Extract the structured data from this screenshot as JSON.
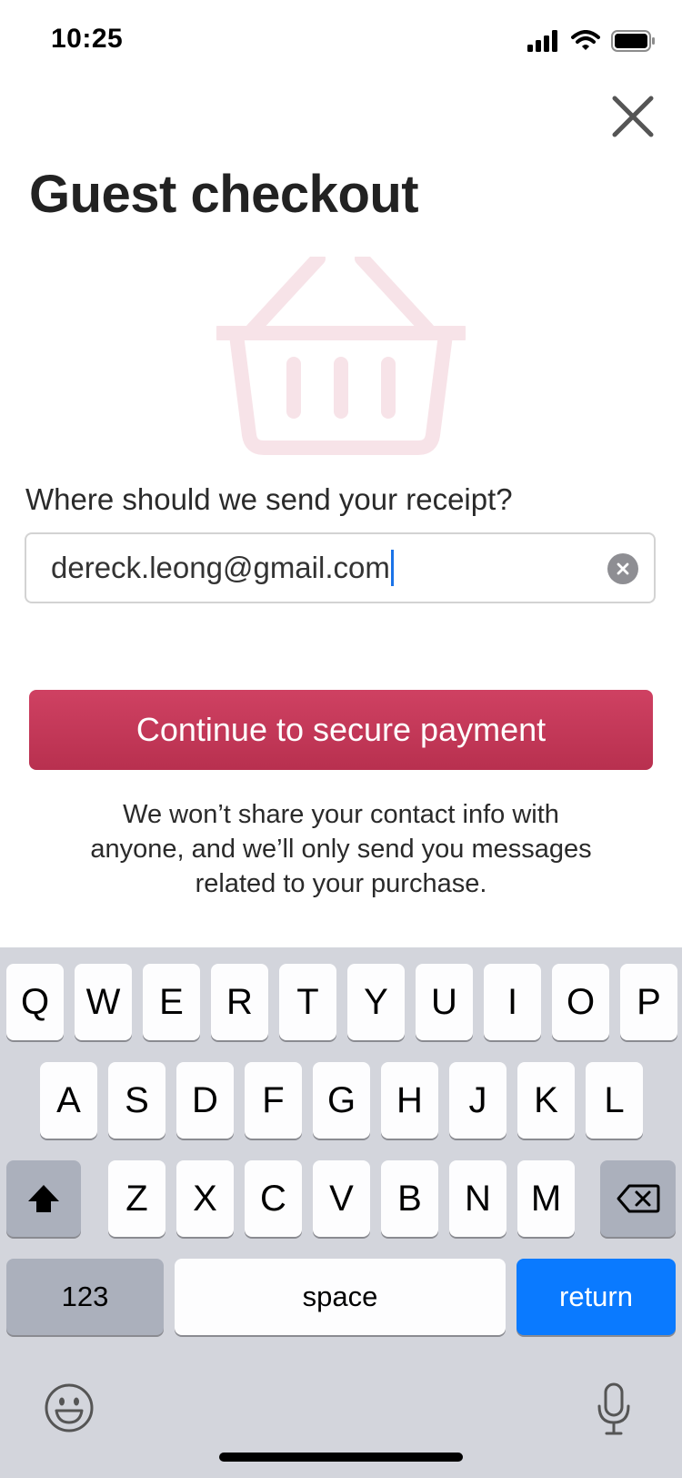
{
  "status_bar": {
    "time": "10:25"
  },
  "title": "Guest checkout",
  "form": {
    "prompt": "Where should we send your receipt?",
    "email_value": "dereck.leong@gmail.com"
  },
  "cta_label": "Continue to secure payment",
  "disclaimer": "We won’t share your contact info with anyone, and we’ll only send you messages related to your purchase.",
  "keyboard": {
    "row1": [
      "Q",
      "W",
      "E",
      "R",
      "T",
      "Y",
      "U",
      "I",
      "O",
      "P"
    ],
    "row2": [
      "A",
      "S",
      "D",
      "F",
      "G",
      "H",
      "J",
      "K",
      "L"
    ],
    "row3": [
      "Z",
      "X",
      "C",
      "V",
      "B",
      "N",
      "M"
    ],
    "numbers_label": "123",
    "space_label": "space",
    "return_label": "return"
  },
  "colors": {
    "accent": "#c4385a",
    "basket_tint": "#f7e3e8",
    "return_key": "#0a7aff",
    "keyboard_bg": "#d3d5dc"
  },
  "icons": [
    "signal-icon",
    "wifi-icon",
    "battery-icon",
    "close-icon",
    "basket-icon",
    "clear-icon",
    "shift-icon",
    "backspace-icon",
    "emoji-icon",
    "microphone-icon"
  ]
}
